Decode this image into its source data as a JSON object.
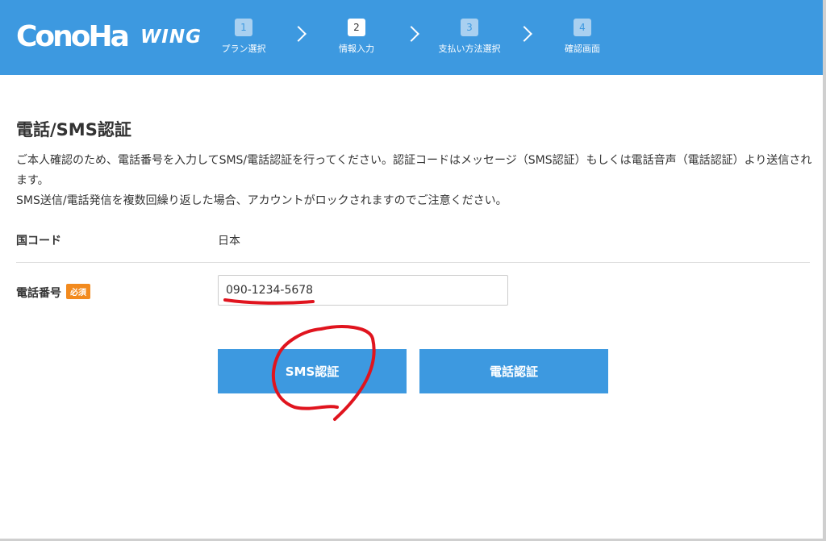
{
  "header": {
    "logo_main": "ConoHa",
    "logo_sub": "WING",
    "steps": [
      {
        "num": "1",
        "label": "プラン選択"
      },
      {
        "num": "2",
        "label": "情報入力"
      },
      {
        "num": "3",
        "label": "支払い方法選択"
      },
      {
        "num": "4",
        "label": "確認画面"
      }
    ],
    "active_step": "2"
  },
  "main": {
    "title": "電話/SMS認証",
    "description_line1": "ご本人確認のため、電話番号を入力してSMS/電話認証を行ってください。認証コードはメッセージ（SMS認証）もしくは電話音声（電話認証）より送信されます。",
    "description_line2": "SMS送信/電話発信を複数回繰り返した場合、アカウントがロックされますのでご注意ください。",
    "country": {
      "label": "国コード",
      "value": "日本"
    },
    "phone": {
      "label": "電話番号",
      "required_badge": "必須",
      "value": "090-1234-5678",
      "placeholder": ""
    },
    "buttons": {
      "sms": "SMS認証",
      "call": "電話認証"
    }
  },
  "colors": {
    "header_bg": "#3d99e0",
    "button_bg": "#3d99e0",
    "badge_bg": "#f28a1e",
    "annotation": "#e0141e"
  }
}
